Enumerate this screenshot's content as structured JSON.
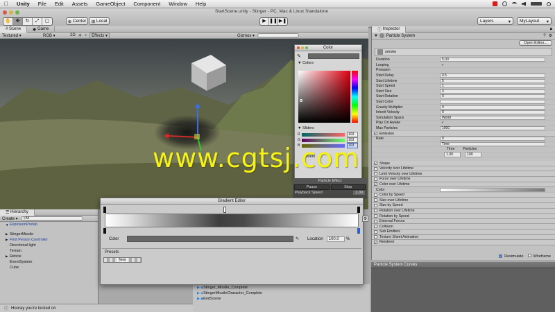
{
  "menubar": {
    "app": "Unity",
    "items": [
      "File",
      "Edit",
      "Assets",
      "GameObject",
      "Component",
      "Window",
      "Help"
    ]
  },
  "titlebar": {
    "title": "StartScene.unity - Stinger - PC, Mac & Linux Standalone",
    "pivot": "Center",
    "space": "Local",
    "layers": "Layers",
    "layout": "MyLayout"
  },
  "scene": {
    "tabs": [
      "Scene",
      "Game"
    ],
    "render_mode": "Textured",
    "color_mode": "RGB",
    "dim": "2D",
    "effects": "Effects",
    "gizmos": "Gizmos"
  },
  "color_picker": {
    "title": "Color",
    "colors_label": "Colors",
    "sliders_label": "Sliders",
    "r_label": "R",
    "g_label": "G",
    "b_label": "B",
    "r": 103,
    "g": 103,
    "b": 103,
    "presets_label": "esets"
  },
  "particle_effect": {
    "title": "Particle Effect",
    "pause": "Pause",
    "stop": "Stop",
    "playback_label": "Playback Speed",
    "playback_value": "1.00"
  },
  "inspector": {
    "tab": "Inspector",
    "header": "Particle System",
    "open_editor": "Open Editor...",
    "system_name": "smoke",
    "props": [
      {
        "label": "Duration",
        "value": "5.00"
      },
      {
        "label": "Looping",
        "value": "✓"
      },
      {
        "label": "Prewarm",
        "value": ""
      },
      {
        "label": "Start Delay",
        "value": "0.5"
      },
      {
        "label": "Start Lifetime",
        "value": "5"
      },
      {
        "label": "Start Speed",
        "value": "1"
      },
      {
        "label": "Start Size",
        "value": "3"
      },
      {
        "label": "Start Rotation",
        "value": "0"
      },
      {
        "label": "Start Color",
        "value": ""
      },
      {
        "label": "Gravity Multiplier",
        "value": "0"
      },
      {
        "label": "Inherit Velocity",
        "value": "0"
      },
      {
        "label": "Simulation Space",
        "value": "World"
      },
      {
        "label": "Play On Awake",
        "value": "✓"
      },
      {
        "label": "Max Particles",
        "value": "1000"
      }
    ],
    "emission": {
      "label": "Emission",
      "rate_label": "Rate",
      "rate_value": "0",
      "rate_mode": "Time",
      "bursts_label": "Bursts",
      "col_time": "Time",
      "col_particles": "Particles",
      "time_value": "1.00",
      "particles_value": "100"
    },
    "modules_top": [
      {
        "label": "Shape",
        "checked": true
      },
      {
        "label": "Velocity over Lifetime",
        "checked": false
      },
      {
        "label": "Limit Velocity over Lifetime",
        "checked": false
      },
      {
        "label": "Force over Lifetime",
        "checked": false
      },
      {
        "label": "Color over Lifetime",
        "checked": true
      }
    ],
    "color_label": "Color",
    "modules_bottom": [
      {
        "label": "Color by Speed",
        "checked": false
      },
      {
        "label": "Size over Lifetime",
        "checked": false
      },
      {
        "label": "Size by Speed",
        "checked": false
      },
      {
        "label": "Rotation over Lifetime",
        "checked": false
      },
      {
        "label": "Rotation by Speed",
        "checked": false
      },
      {
        "label": "External Forces",
        "checked": false
      },
      {
        "label": "Collision",
        "checked": false
      },
      {
        "label": "Sub Emitters",
        "checked": false
      },
      {
        "label": "Texture Sheet Animation",
        "checked": false
      },
      {
        "label": "Renderer",
        "checked": true
      }
    ],
    "resimulate": "Resimulate",
    "wireframe": "Wireframe"
  },
  "curves": {
    "title": "Particle System Curves"
  },
  "hierarchy": {
    "tab": "Hierarchy",
    "create": "Create",
    "search": "All",
    "items": [
      {
        "label": "ExplosionPrefab",
        "color": "#1d3fa0",
        "arrow": "▼"
      },
      {
        "label": "",
        "color": "#111",
        "arrow": ""
      },
      {
        "label": "StingerMissile",
        "color": "#111",
        "arrow": "▶"
      },
      {
        "label": "First Person Controller",
        "color": "#1d3fa0",
        "arrow": "▶"
      },
      {
        "label": "Directional light",
        "color": "#111",
        "arrow": ""
      },
      {
        "label": "Terrain",
        "color": "#111",
        "arrow": ""
      },
      {
        "label": "Reticle",
        "color": "#111",
        "arrow": "▶"
      },
      {
        "label": "EventSystem",
        "color": "#111",
        "arrow": ""
      },
      {
        "label": "Cube",
        "color": "#111",
        "arrow": ""
      }
    ]
  },
  "gradient_editor": {
    "title": "Gradient Editor",
    "color_label": "Color",
    "location_label": "Location",
    "location_value": "100.0",
    "location_unit": "%",
    "presets_label": "Presets",
    "preset_new": "New"
  },
  "project": {
    "items": [
      "Stinger_Missile_Complete",
      "StingerMissileCharacter_Complete",
      "EndScene"
    ]
  },
  "status": {
    "text": "Hooray you're locked on"
  },
  "watermark": {
    "text": "www.cgtsj.com"
  },
  "colors": {
    "accent": "#3d6fd6",
    "watermark": "#f5f214"
  }
}
